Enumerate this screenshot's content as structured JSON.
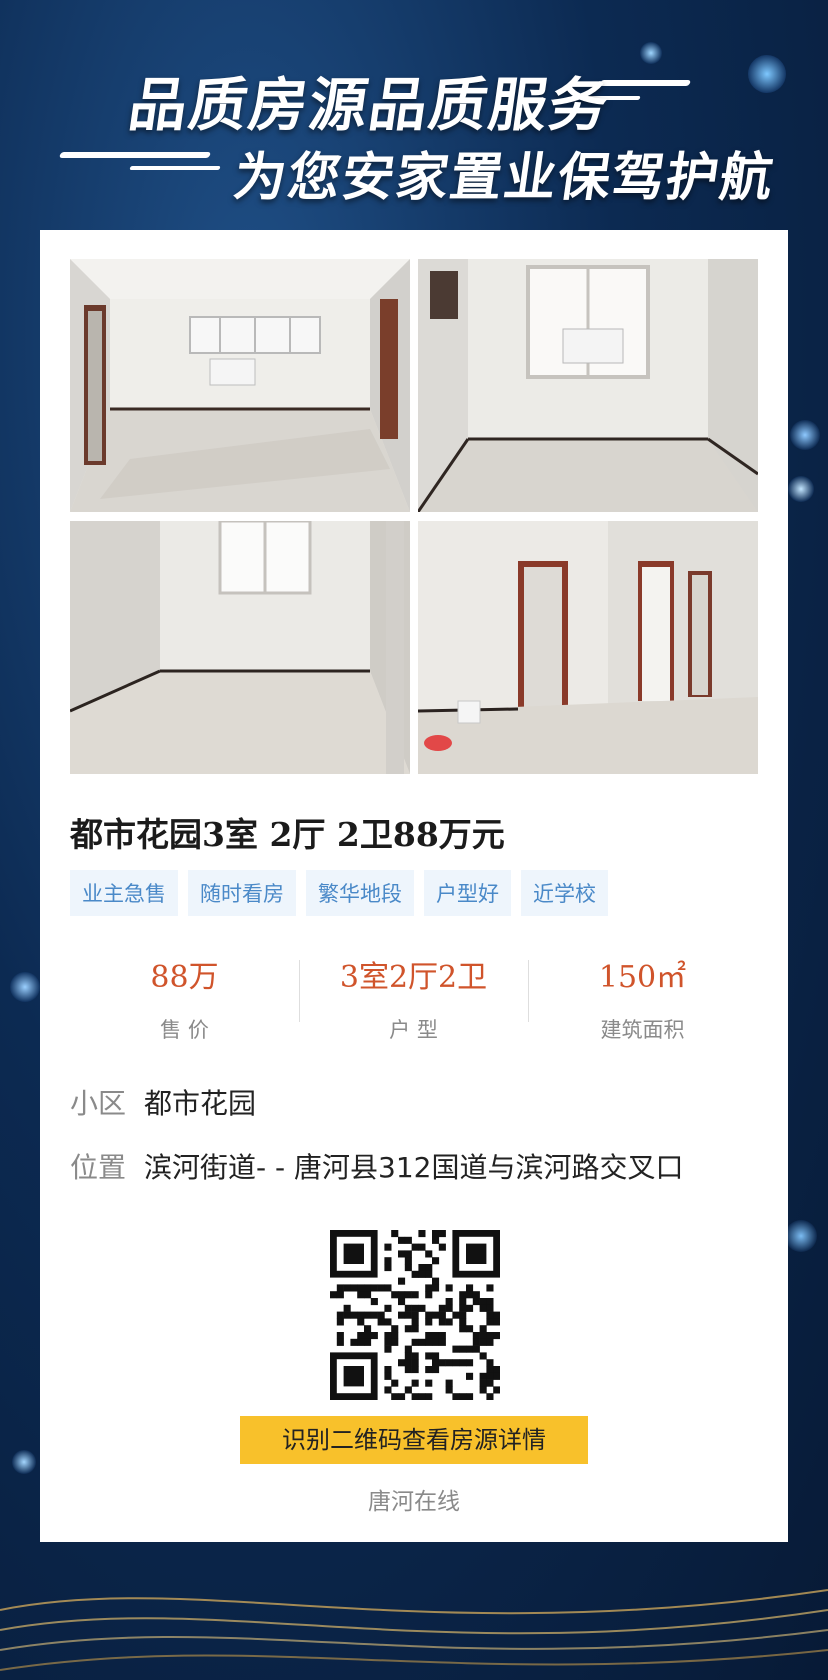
{
  "header": {
    "line1": "品质房源品质服务",
    "line2": "为您安家置业保驾护航"
  },
  "listing": {
    "title": "都市花园3室 2厅 2卫88万元",
    "tags": [
      "业主急售",
      "随时看房",
      "繁华地段",
      "户型好",
      "近学校"
    ],
    "stats": [
      {
        "value": "88万",
        "label": "售 价"
      },
      {
        "value": "3室2厅2卫",
        "label": "户 型"
      },
      {
        "value": "150㎡",
        "label": "建筑面积"
      }
    ],
    "community_key": "小区",
    "community_value": "都市花园",
    "location_key": "位置",
    "location_value": "滨河街道- - 唐河县312国道与滨河路交叉口"
  },
  "qr": {
    "button_label": "识别二维码查看房源详情",
    "brand": "唐河在线"
  },
  "colors": {
    "accent_price": "#d0542b",
    "tag_text": "#4a89c8",
    "tag_bg": "#eef5fc",
    "cta_bg": "#f8c12b"
  }
}
